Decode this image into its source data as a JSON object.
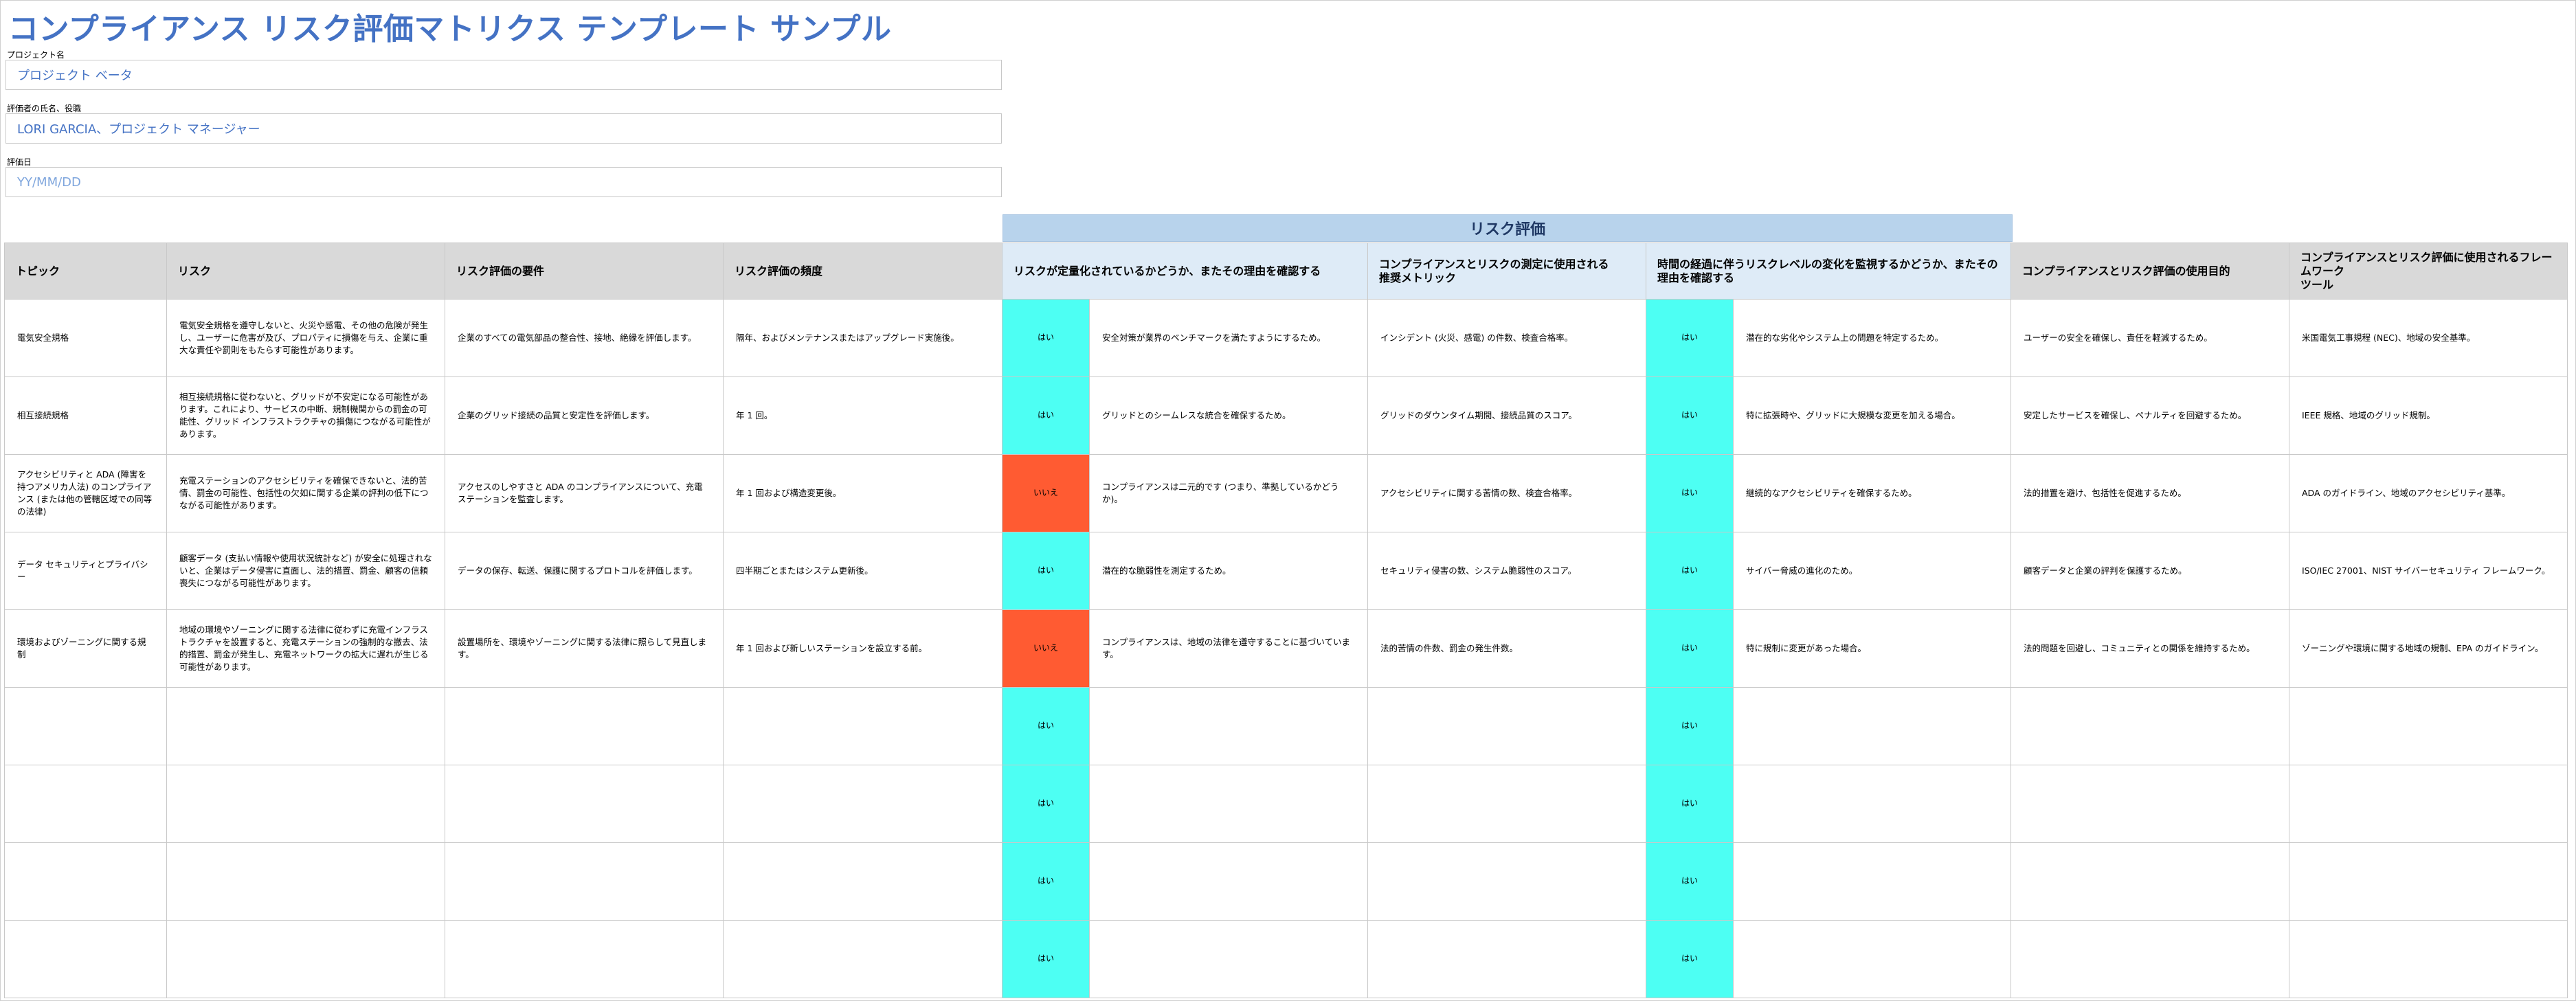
{
  "page_title": "コンプライアンス リスク評価マトリクス テンプレート サンプル",
  "fields": [
    {
      "label": "プロジェクト名",
      "value": "プロジェクト ベータ"
    },
    {
      "label": "評価者の氏名、役職",
      "value": "LORI GARCIA、プロジェクト マネージャー"
    },
    {
      "label": "評価日",
      "value": "YY/MM/DD"
    }
  ],
  "risk_section_title": "リスク評価",
  "columns": [
    "トピック",
    "リスク",
    "リスク評価の要件",
    "リスク評価の頻度",
    "リスクが定量化されているかどうか、またその理由を確認する",
    "コンプライアンスとリスクの測定に使用される\n推奨メトリック",
    "時間の経過に伴うリスクレベルの変化を監視するかどうか、またその理由を確認する",
    "コンプライアンスとリスク評価の使用目的",
    "コンプライアンスとリスク評価に使用されるフレームワーク\nツール"
  ],
  "flag_colors": {
    "はい": "#4dfff3",
    "いいえ": "#ff5b32"
  },
  "rows": [
    {
      "topic": "電気安全規格",
      "risk": "電気安全規格を遵守しないと、火災や感電、その他の危険が発生し、ユーザーに危害が及び、プロパティに損傷を与え、企業に重大な責任や罰則をもたらす可能性があります。",
      "requirement": "企業のすべての電気部品の整合性、接地、絶縁を評価します。",
      "frequency": "隔年、およびメンテナンスまたはアップグレード実施後。",
      "quantified": "はい",
      "quantified_reason": "安全対策が業界のベンチマークを満たすようにするため。",
      "metrics": "インシデント (火災、感電) の件数、検査合格率。",
      "monitored": "はい",
      "monitored_reason": "潜在的な劣化やシステム上の問題を特定するため。",
      "purpose": "ユーザーの安全を確保し、責任を軽減するため。",
      "framework": "米国電気工事規程 (NEC)、地域の安全基準。"
    },
    {
      "topic": "相互接続規格",
      "risk": "相互接続規格に従わないと、グリッドが不安定になる可能性があります。これにより、サービスの中断、規制機関からの罰金の可能性、グリッド インフラストラクチャの損傷につながる可能性があります。",
      "requirement": "企業のグリッド接続の品質と安定性を評価します。",
      "frequency": "年 1 回。",
      "quantified": "はい",
      "quantified_reason": "グリッドとのシームレスな統合を確保するため。",
      "metrics": "グリッドのダウンタイム期間、接続品質のスコア。",
      "monitored": "はい",
      "monitored_reason": "特に拡張時や、グリッドに大規模な変更を加える場合。",
      "purpose": "安定したサービスを確保し、ペナルティを回避するため。",
      "framework": "IEEE 規格、地域のグリッド規制。"
    },
    {
      "topic": "アクセシビリティと ADA (障害を持つアメリカ人法) のコンプライアンス (または他の管轄区域での同等の法律)",
      "risk": "充電ステーションのアクセシビリティを確保できないと、法的苦情、罰金の可能性、包括性の欠如に関する企業の評判の低下につながる可能性があります。",
      "requirement": "アクセスのしやすさと ADA のコンプライアンスについて、充電ステーションを監査します。",
      "frequency": "年 1 回および構造変更後。",
      "quantified": "いいえ",
      "quantified_reason": "コンプライアンスは二元的です (つまり、準拠しているかどうか)。",
      "metrics": "アクセシビリティに関する苦情の数、検査合格率。",
      "monitored": "はい",
      "monitored_reason": "継続的なアクセシビリティを確保するため。",
      "purpose": "法的措置を避け、包括性を促進するため。",
      "framework": "ADA のガイドライン、地域のアクセシビリティ基準。"
    },
    {
      "topic": "データ セキュリティとプライバシー",
      "risk": "顧客データ (支払い情報や使用状況統計など) が安全に処理されないと、企業はデータ侵害に直面し、法的措置、罰金、顧客の信頼喪失につながる可能性があります。",
      "requirement": "データの保存、転送、保護に関するプロトコルを評価します。",
      "frequency": "四半期ごとまたはシステム更新後。",
      "quantified": "はい",
      "quantified_reason": "潜在的な脆弱性を測定するため。",
      "metrics": "セキュリティ侵害の数、システム脆弱性のスコア。",
      "monitored": "はい",
      "monitored_reason": "サイバー脅威の進化のため。",
      "purpose": "顧客データと企業の評判を保護するため。",
      "framework": "ISO/IEC 27001、NIST サイバーセキュリティ フレームワーク。"
    },
    {
      "topic": "環境およびゾーニングに関する規制",
      "risk": "地域の環境やゾーニングに関する法律に従わずに充電インフラストラクチャを設置すると、充電ステーションの強制的な撤去、法的措置、罰金が発生し、充電ネットワークの拡大に遅れが生じる可能性があります。",
      "requirement": "設置場所を、環境やゾーニングに関する法律に照らして見直します。",
      "frequency": "年 1 回および新しいステーションを設立する前。",
      "quantified": "いいえ",
      "quantified_reason": "コンプライアンスは、地域の法律を遵守することに基づいています。",
      "metrics": "法的苦情の件数、罰金の発生件数。",
      "monitored": "はい",
      "monitored_reason": "特に規制に変更があった場合。",
      "purpose": "法的問題を回避し、コミュニティとの関係を維持するため。",
      "framework": "ゾーニングや環境に関する地域の規制、EPA のガイドライン。"
    },
    {
      "topic": "",
      "risk": "",
      "requirement": "",
      "frequency": "",
      "quantified": "はい",
      "quantified_reason": "",
      "metrics": "",
      "monitored": "はい",
      "monitored_reason": "",
      "purpose": "",
      "framework": ""
    },
    {
      "topic": "",
      "risk": "",
      "requirement": "",
      "frequency": "",
      "quantified": "はい",
      "quantified_reason": "",
      "metrics": "",
      "monitored": "はい",
      "monitored_reason": "",
      "purpose": "",
      "framework": ""
    },
    {
      "topic": "",
      "risk": "",
      "requirement": "",
      "frequency": "",
      "quantified": "はい",
      "quantified_reason": "",
      "metrics": "",
      "monitored": "はい",
      "monitored_reason": "",
      "purpose": "",
      "framework": ""
    },
    {
      "topic": "",
      "risk": "",
      "requirement": "",
      "frequency": "",
      "quantified": "はい",
      "quantified_reason": "",
      "metrics": "",
      "monitored": "はい",
      "monitored_reason": "",
      "purpose": "",
      "framework": ""
    }
  ]
}
